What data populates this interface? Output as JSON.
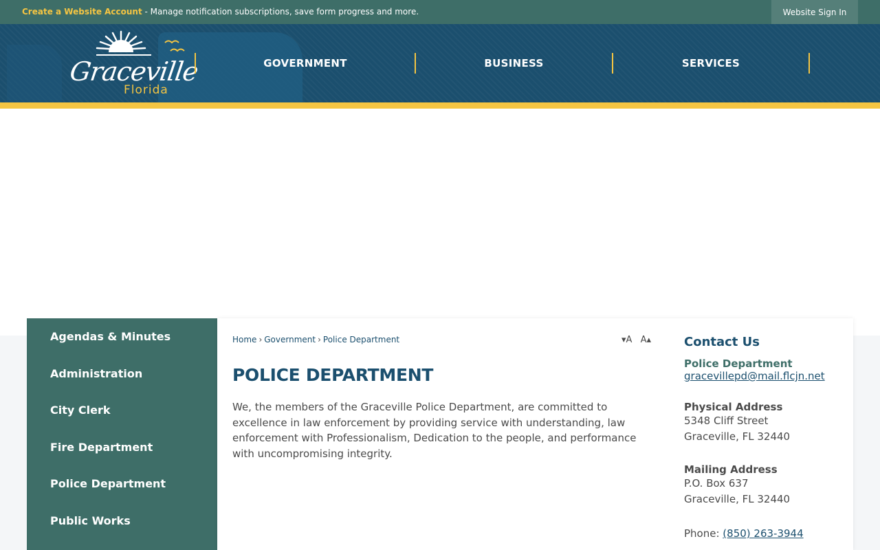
{
  "topbar": {
    "create_account_link": "Create a Website Account",
    "notice_text": " - Manage notification subscriptions, save form progress and more.",
    "signin_button": "Website Sign In"
  },
  "logo": {
    "script_text": "Graceville",
    "state_text": "Florida"
  },
  "nav": {
    "items": [
      "GOVERNMENT",
      "BUSINESS",
      "SERVICES"
    ]
  },
  "sidebar": {
    "items": [
      "Agendas & Minutes",
      "Administration",
      "City Clerk",
      "Fire Department",
      "Police Department",
      "Public Works"
    ]
  },
  "breadcrumb": {
    "items": [
      "Home",
      "Government",
      "Police Department"
    ],
    "separator": "›"
  },
  "text_resize": {
    "decrease": "▾A",
    "increase": "A▴"
  },
  "page": {
    "title": "POLICE DEPARTMENT",
    "body": "We, the members of the Graceville Police Department, are committed to excellence in law enforcement by providing service with understanding, law enforcement with Professionalism, Dedication to the people, and performance with uncompromising integrity."
  },
  "contact": {
    "heading": "Contact Us",
    "department": "Police Department",
    "email": "gracevillepd@mail.flcjn.net",
    "physical_label": "Physical Address",
    "physical_line1": "5348 Cliff Street",
    "physical_line2": "Graceville, FL 32440",
    "mailing_label": "Mailing Address",
    "mailing_line1": "P.O. Box 637",
    "mailing_line2": "Graceville, FL 32440",
    "phone_label": "Phone: ",
    "phone_number": "(850) 263-3944"
  },
  "colors": {
    "header_blue": "#1b4f6e",
    "teal": "#3e6e68",
    "gold": "#f5c542"
  }
}
